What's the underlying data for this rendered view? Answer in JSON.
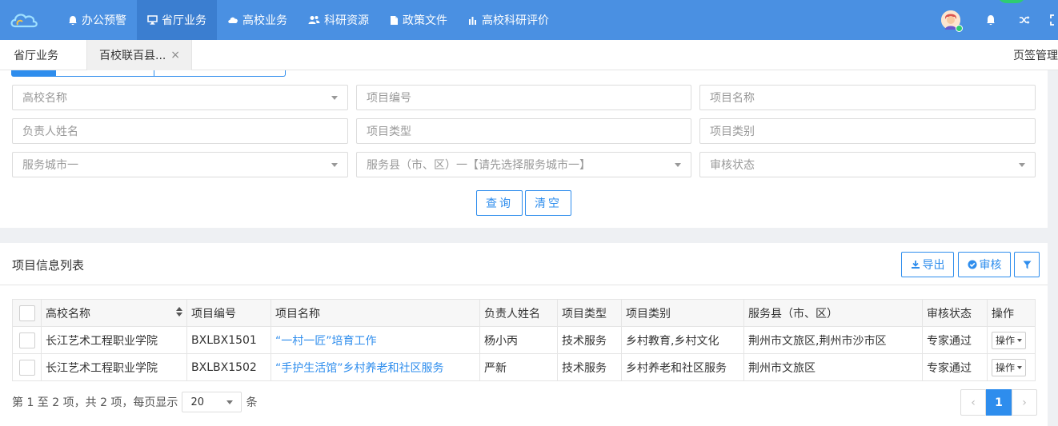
{
  "nav": {
    "items": [
      {
        "label": "办公预警",
        "icon": "bell-icon"
      },
      {
        "label": "省厅业务",
        "icon": "monitor-icon",
        "active": true
      },
      {
        "label": "高校业务",
        "icon": "cloud-icon"
      },
      {
        "label": "科研资源",
        "icon": "users-icon"
      },
      {
        "label": "政策文件",
        "icon": "file-icon"
      },
      {
        "label": "高校科研评价",
        "icon": "bar-chart-icon"
      }
    ]
  },
  "tabs": {
    "tab1": "省厅业务",
    "tab2": "百校联百县...",
    "close": "×",
    "manage": "页签管理"
  },
  "search": {
    "school_placeholder": "高校名称",
    "code_placeholder": "项目编号",
    "name_placeholder": "项目名称",
    "leader_placeholder": "负责人姓名",
    "type_placeholder": "项目类型",
    "category_placeholder": "项目类别",
    "city_placeholder": "服务城市一",
    "county_placeholder": "服务县（市、区）一【请先选择服务城市一】",
    "status_placeholder": "审核状态",
    "query_label": "查询",
    "clear_label": "清空"
  },
  "list": {
    "title": "项目信息列表",
    "export_label": "导出",
    "review_label": "审核",
    "columns": [
      "高校名称",
      "项目编号",
      "项目名称",
      "负责人姓名",
      "项目类型",
      "项目类别",
      "服务县（市、区）",
      "审核状态",
      "操作"
    ],
    "rows": [
      [
        "长江艺术工程职业学院",
        "BXLBX1501",
        "“一村一匠”培育工作",
        "杨小丙",
        "技术服务",
        "乡村教育,乡村文化",
        "荆州市文旅区,荆州市沙市区",
        "专家通过",
        "操作"
      ],
      [
        "长江艺术工程职业学院",
        "BXLBX1502",
        "“手护生活馆”乡村养老和社区服务",
        "严新",
        "技术服务",
        "乡村养老和社区服务",
        "荆州市文旅区",
        "专家通过",
        "操作"
      ]
    ]
  },
  "pager": {
    "info": "第 1 至 2 项，共 2 项，每页显示",
    "page_size": "20",
    "unit": "条",
    "current": "1",
    "prev": "‹",
    "next": "›"
  },
  "colors": {
    "topbar": "#4a90e2",
    "accent": "#2e8ded"
  }
}
